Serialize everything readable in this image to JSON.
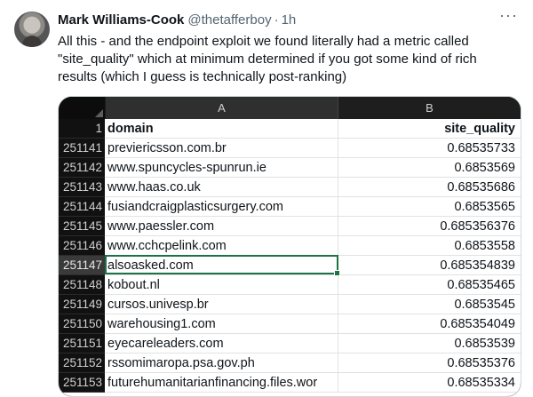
{
  "tweet": {
    "author": "Mark Williams-Cook",
    "handle": "@thetafferboy",
    "separator": "·",
    "time": "1h",
    "more_icon": "more-horizontal-icon",
    "text": "All this - and the endpoint exploit we found literally had a metric called \"site_quality\" which at minimum determined if you got some kind of rich results (which I guess is technically post-ranking)"
  },
  "spreadsheet": {
    "columns": [
      "A",
      "B"
    ],
    "header_row": {
      "num": "1",
      "a": "domain",
      "b": "site_quality"
    },
    "selected_row": "251147",
    "accent": "#1e7145",
    "rows": [
      {
        "num": "251141",
        "a": "previericsson.com.br",
        "b": "0.68535733"
      },
      {
        "num": "251142",
        "a": "www.spuncycles-spunrun.ie",
        "b": "0.6853569"
      },
      {
        "num": "251143",
        "a": "www.haas.co.uk",
        "b": "0.68535686"
      },
      {
        "num": "251144",
        "a": "fusiandcraigplasticsurgery.com",
        "b": "0.6853565"
      },
      {
        "num": "251145",
        "a": "www.paessler.com",
        "b": "0.685356376"
      },
      {
        "num": "251146",
        "a": "www.cchcpelink.com",
        "b": "0.6853558"
      },
      {
        "num": "251147",
        "a": "alsoasked.com",
        "b": "0.685354839"
      },
      {
        "num": "251148",
        "a": "kobout.nl",
        "b": "0.68535465"
      },
      {
        "num": "251149",
        "a": "cursos.univesp.br",
        "b": "0.6853545"
      },
      {
        "num": "251150",
        "a": "warehousing1.com",
        "b": "0.685354049"
      },
      {
        "num": "251151",
        "a": "eyecareleaders.com",
        "b": "0.6853539"
      },
      {
        "num": "251152",
        "a": "rssomimaropa.psa.gov.ph",
        "b": "0.68535376"
      },
      {
        "num": "251153",
        "a": "futurehumanitarianfinancing.files.wor",
        "b": "0.68535334"
      }
    ]
  }
}
